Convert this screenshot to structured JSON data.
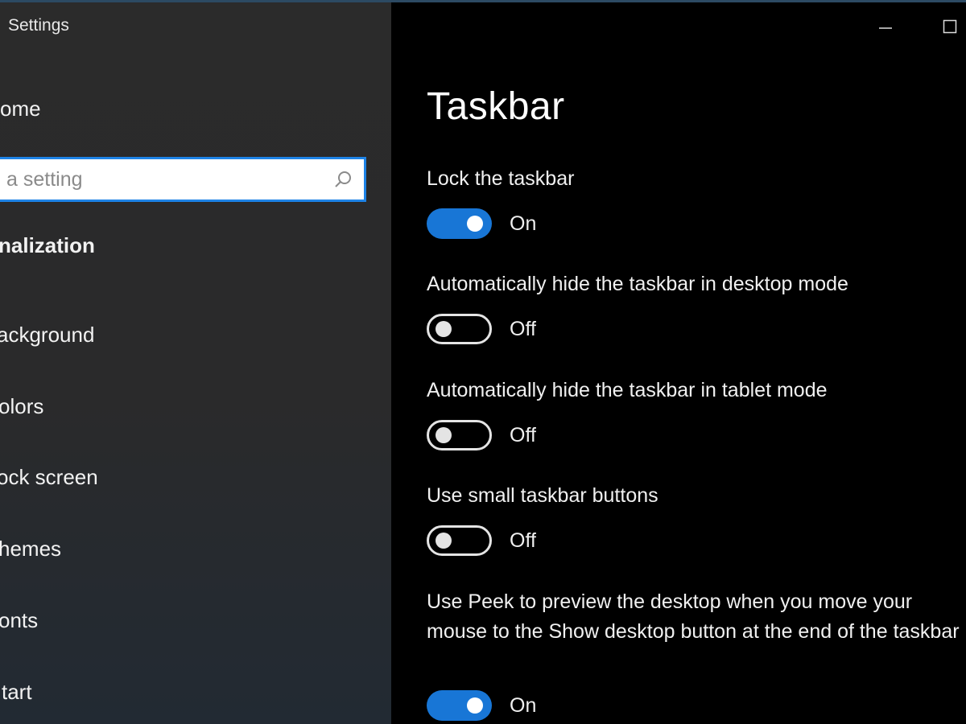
{
  "window": {
    "title": "Settings"
  },
  "sidebar": {
    "home_label": "ome",
    "search": {
      "placeholder": "a setting"
    },
    "section_title": "nalization",
    "items": [
      {
        "label": "ackground"
      },
      {
        "label": "olors"
      },
      {
        "label": "ock screen"
      },
      {
        "label": "hemes"
      },
      {
        "label": "onts"
      },
      {
        "label": "tart"
      }
    ]
  },
  "main": {
    "title": "Taskbar",
    "settings": [
      {
        "label": "Lock the taskbar",
        "state": "On"
      },
      {
        "label": "Automatically hide the taskbar in desktop mode",
        "state": "Off"
      },
      {
        "label": "Automatically hide the taskbar in tablet mode",
        "state": "Off"
      },
      {
        "label": "Use small taskbar buttons",
        "state": "Off"
      },
      {
        "label": "Use Peek to preview the desktop when you move your mouse to the Show desktop button at the end of the taskbar",
        "state": "On"
      }
    ]
  },
  "colors": {
    "accent": "#1876d6",
    "search_border": "#1e83e6"
  }
}
